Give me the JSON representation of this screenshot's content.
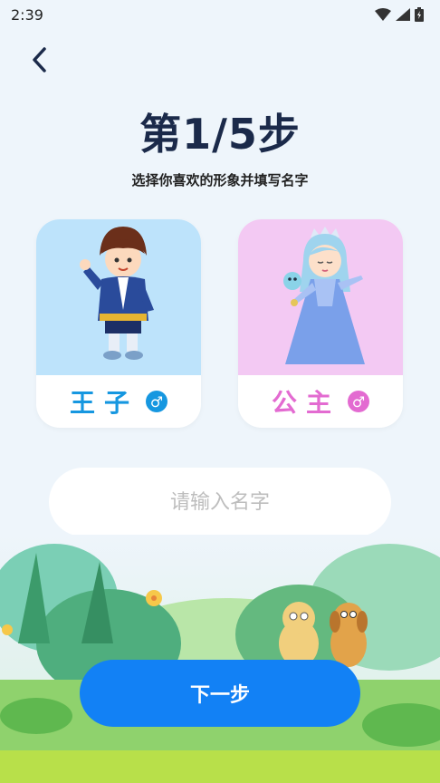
{
  "status_bar": {
    "time": "2:39"
  },
  "header": {
    "step_title": "第1/5步",
    "subtitle": "选择你喜欢的形象并填写名字"
  },
  "cards": [
    {
      "label": "王子",
      "color": "#1697e0",
      "gender_icon": "male-icon"
    },
    {
      "label": "公主",
      "color": "#e36bd1",
      "gender_icon": "male-icon"
    }
  ],
  "name_input": {
    "placeholder": "请输入名字",
    "value": ""
  },
  "next_button": {
    "label": "下一步"
  },
  "colors": {
    "primary": "#1281f5",
    "title": "#1b2a4a",
    "prince_bg": "#bde3fb",
    "princess_bg": "#f3c9f3"
  }
}
